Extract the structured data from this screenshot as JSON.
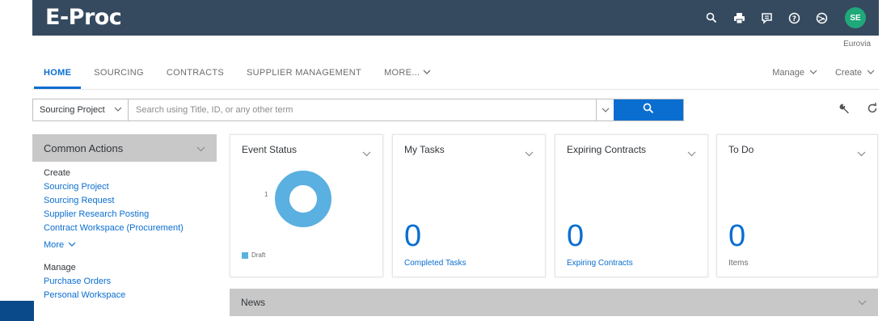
{
  "app": {
    "title": "E-Proc",
    "org": "Eurovia",
    "user_initials": "SE"
  },
  "header_icons": [
    "search-icon",
    "print-icon",
    "chat-icon",
    "help-icon",
    "globe-icon"
  ],
  "tabs": [
    {
      "label": "HOME",
      "active": true
    },
    {
      "label": "SOURCING",
      "active": false
    },
    {
      "label": "CONTRACTS",
      "active": false
    },
    {
      "label": "SUPPLIER MANAGEMENT",
      "active": false
    },
    {
      "label": "MORE...",
      "active": false
    }
  ],
  "nav_right": {
    "manage": "Manage",
    "create": "Create"
  },
  "search": {
    "scope": "Sourcing Project",
    "placeholder": "Search using Title, ID, or any other term",
    "value": ""
  },
  "sidebar": {
    "title": "Common Actions",
    "create_label": "Create",
    "create_links": [
      "Sourcing Project",
      "Sourcing Request",
      "Supplier Research Posting",
      "Contract Workspace (Procurement)"
    ],
    "more_label": "More",
    "manage_label": "Manage",
    "manage_links": [
      "Purchase Orders",
      "Personal Workspace"
    ]
  },
  "tiles": {
    "event_status": {
      "title": "Event Status",
      "axis_label": "1",
      "legend": "Draft",
      "donut_color": "#5ab0e0"
    },
    "my_tasks": {
      "title": "My Tasks",
      "count": "0",
      "sub": "Completed Tasks"
    },
    "expiring_contracts": {
      "title": "Expiring Contracts",
      "count": "0",
      "sub": "Expiring Contracts"
    },
    "todo": {
      "title": "To Do",
      "count": "0",
      "sub": "Items"
    }
  },
  "news": {
    "title": "News"
  },
  "colors": {
    "shell": "#354a5f",
    "accent": "#0a6ed1",
    "avatar": "#1fa87a"
  }
}
